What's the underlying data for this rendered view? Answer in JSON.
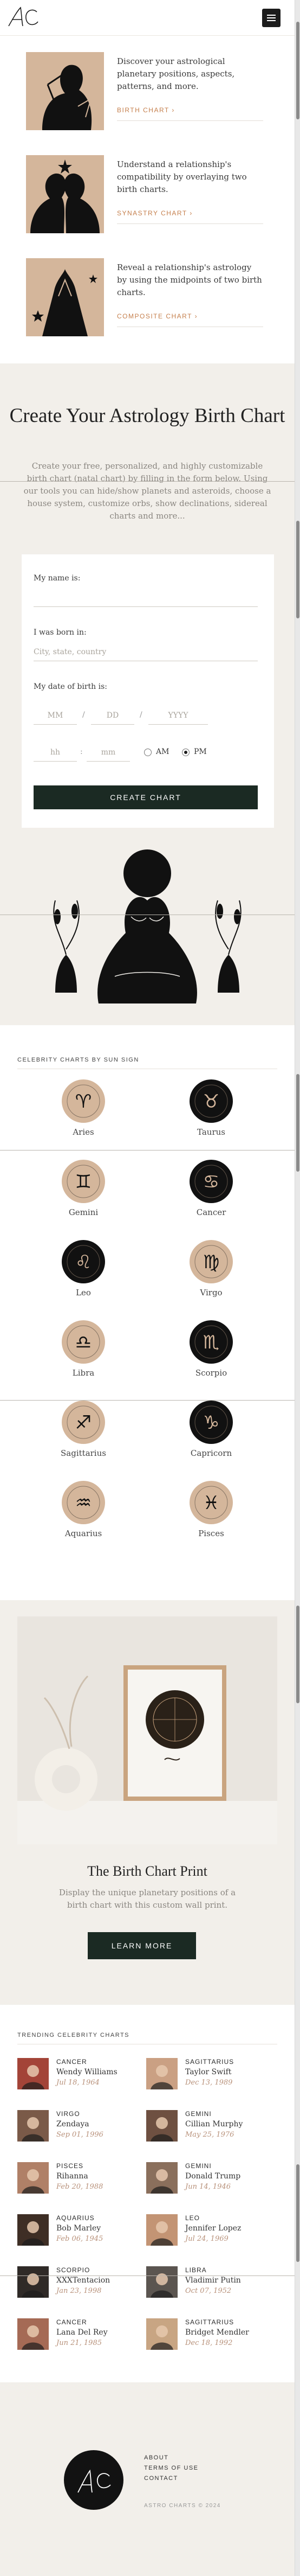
{
  "header": {
    "logo_text": "AC",
    "menu_icon": "hamburger-icon"
  },
  "features": [
    {
      "text": "Discover your astrological planetary positions, aspects, patterns, and more.",
      "link": "BIRTH CHART ›"
    },
    {
      "text": "Understand a relationship's compatibility by overlaying two birth charts.",
      "link": "SYNASTRY CHART ›"
    },
    {
      "text": "Reveal a relationship's astrology by using the midpoints of two birth charts.",
      "link": "COMPOSITE CHART ›"
    }
  ],
  "create": {
    "title": "Create Your Astrology Birth Chart",
    "intro": "Create your free, personalized, and highly customizable birth chart (natal chart) by filling in the form below. Using our tools you can hide/show planets and asteroids, choose a house system, customize orbs, show declinations, sidereal charts and more...",
    "form": {
      "name_label": "My name is:",
      "born_label": "I was born in:",
      "born_placeholder": "City, state, country",
      "date_label": "My date of birth is:",
      "mm": "MM",
      "dd": "DD",
      "yyyy": "YYYY",
      "hh": "hh",
      "min": "mm",
      "am": "AM",
      "pm": "PM",
      "submit": "CREATE CHART"
    }
  },
  "signs": {
    "title": "CELEBRITY CHARTS BY SUN SIGN",
    "items": [
      "Aries",
      "Taurus",
      "Gemini",
      "Cancer",
      "Leo",
      "Virgo",
      "Libra",
      "Scorpio",
      "Sagittarius",
      "Capricorn",
      "Aquarius",
      "Pisces"
    ]
  },
  "print": {
    "title": "The Birth Chart Print",
    "text": "Display the unique planetary positions of a birth chart with this custom wall print.",
    "button": "LEARN MORE"
  },
  "trending": {
    "title": "TRENDING CELEBRITY CHARTS",
    "items": [
      {
        "sign": "CANCER",
        "name": "Wendy Williams",
        "date": "Jul 18, 1964"
      },
      {
        "sign": "SAGITTARIUS",
        "name": "Taylor Swift",
        "date": "Dec 13, 1989"
      },
      {
        "sign": "VIRGO",
        "name": "Zendaya",
        "date": "Sep 01, 1996"
      },
      {
        "sign": "GEMINI",
        "name": "Cillian Murphy",
        "date": "May 25, 1976"
      },
      {
        "sign": "PISCES",
        "name": "Rihanna",
        "date": "Feb 20, 1988"
      },
      {
        "sign": "GEMINI",
        "name": "Donald Trump",
        "date": "Jun 14, 1946"
      },
      {
        "sign": "AQUARIUS",
        "name": "Bob Marley",
        "date": "Feb 06, 1945"
      },
      {
        "sign": "LEO",
        "name": "Jennifer Lopez",
        "date": "Jul 24, 1969"
      },
      {
        "sign": "SCORPIO",
        "name": "XXXTentacion",
        "date": "Jan 23, 1998"
      },
      {
        "sign": "LIBRA",
        "name": "Vladimir Putin",
        "date": "Oct 07, 1952"
      },
      {
        "sign": "CANCER",
        "name": "Lana Del Rey",
        "date": "Jun 21, 1985"
      },
      {
        "sign": "SAGITTARIUS",
        "name": "Bridget Mendler",
        "date": "Dec 18, 1992"
      }
    ]
  },
  "footer": {
    "links": [
      "ABOUT",
      "TERMS OF USE",
      "CONTACT"
    ],
    "copyright": "ASTRO CHARTS © 2024",
    "logo_text": "AC"
  },
  "colors": {
    "accent": "#c57f4c",
    "button": "#1b2a23",
    "tan": "#d4b69b",
    "background": "#f2efea"
  }
}
